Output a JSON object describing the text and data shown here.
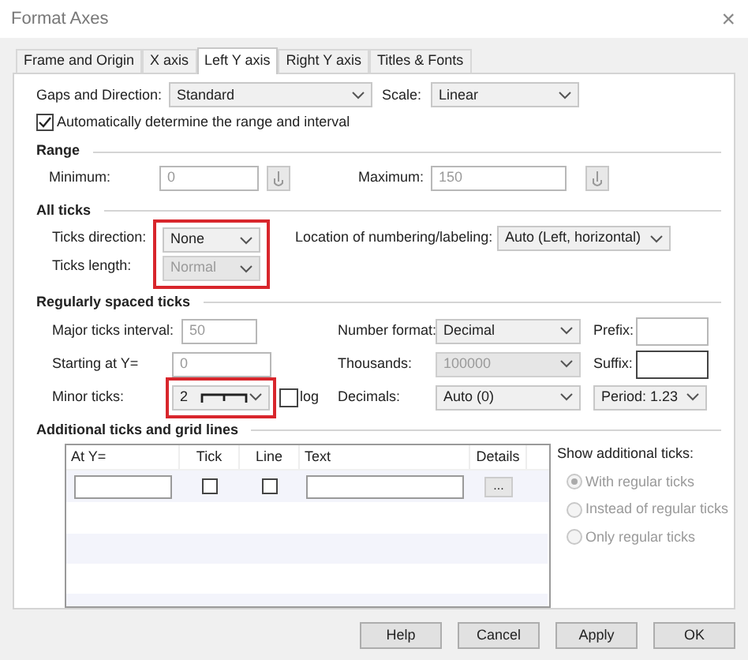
{
  "window": {
    "title": "Format Axes",
    "close": "×"
  },
  "tabs": [
    {
      "label": "Frame and Origin",
      "selected": false
    },
    {
      "label": "X axis",
      "selected": false
    },
    {
      "label": "Left Y axis",
      "selected": true
    },
    {
      "label": "Right Y axis",
      "selected": false
    },
    {
      "label": "Titles & Fonts",
      "selected": false
    }
  ],
  "gaps_direction": {
    "label": "Gaps and Direction:",
    "value": "Standard"
  },
  "scale": {
    "label": "Scale:",
    "value": "Linear"
  },
  "auto_range": {
    "label": "Automatically determine the range and interval",
    "checked": true
  },
  "range": {
    "title": "Range",
    "minimum": {
      "label": "Minimum:",
      "value": "0",
      "disabled": true
    },
    "maximum": {
      "label": "Maximum:",
      "value": "150",
      "disabled": true
    }
  },
  "all_ticks": {
    "title": "All ticks",
    "highlighted": true,
    "ticks_direction": {
      "label": "Ticks direction:",
      "value": "None",
      "disabled": false
    },
    "ticks_length": {
      "label": "Ticks length:",
      "value": "Normal",
      "disabled": true
    },
    "location": {
      "label": "Location of numbering/labeling:",
      "value": "Auto (Left, horizontal)"
    }
  },
  "regular_ticks": {
    "title": "Regularly spaced ticks",
    "major_interval": {
      "label": "Major ticks interval:",
      "value": "50",
      "disabled": true
    },
    "starting_at": {
      "label": "Starting at Y=",
      "value": "0",
      "disabled": true
    },
    "minor_ticks": {
      "label": "Minor ticks:",
      "value": "2",
      "highlighted": true
    },
    "log": {
      "label": "log",
      "checked": false
    },
    "number_format": {
      "label": "Number format:",
      "value": "Decimal",
      "disabled": false
    },
    "thousands": {
      "label": "Thousands:",
      "value": "100000",
      "disabled": true
    },
    "decimals": {
      "label": "Decimals:",
      "value": "Auto (0)",
      "disabled": false
    },
    "prefix": {
      "label": "Prefix:"
    },
    "suffix": {
      "label": "Suffix:"
    },
    "period": {
      "value": "Period: 1.23"
    }
  },
  "additional": {
    "title": "Additional ticks and grid lines",
    "columns": [
      "At Y=",
      "Tick",
      "Line",
      "Text",
      "Details"
    ],
    "row": {
      "tick": false,
      "line": false,
      "details": "..."
    },
    "show_label": "Show additional ticks:",
    "options": [
      {
        "label": "With regular ticks",
        "selected": true,
        "disabled": true
      },
      {
        "label": "Instead of regular ticks",
        "selected": false,
        "disabled": true
      },
      {
        "label": "Only regular ticks",
        "selected": false,
        "disabled": true
      }
    ]
  },
  "buttons": [
    "Help",
    "Cancel",
    "Apply",
    "OK"
  ]
}
